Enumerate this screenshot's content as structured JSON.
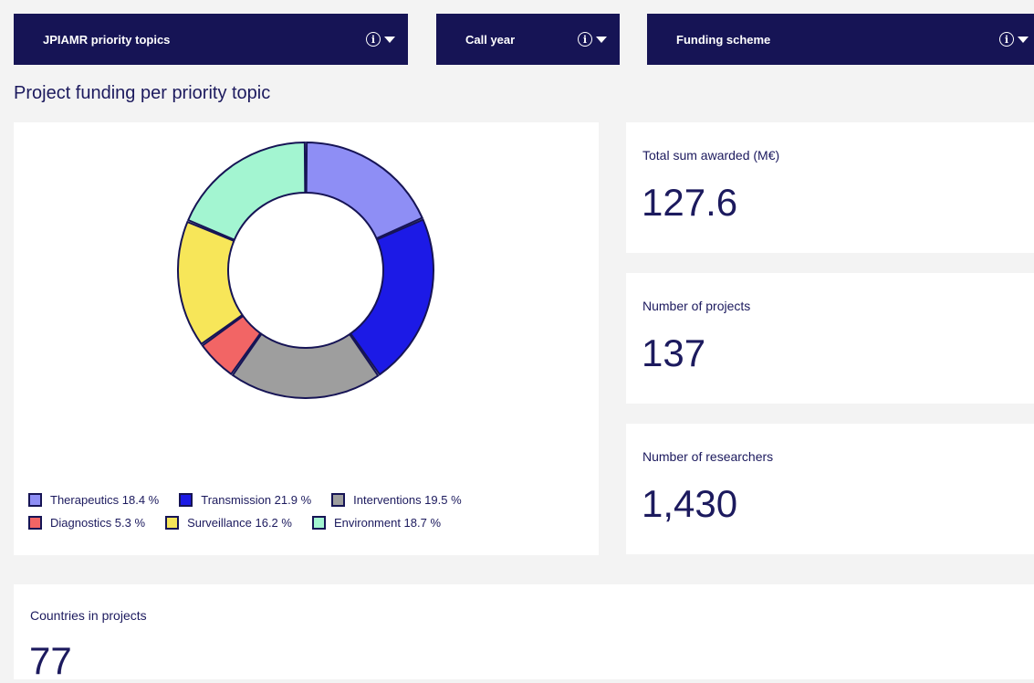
{
  "filters": {
    "topics": {
      "label": "JPIAMR priority topics"
    },
    "year": {
      "label": "Call year"
    },
    "scheme": {
      "label": "Funding scheme"
    }
  },
  "section_title": "Project funding per priority topic",
  "chart_data": {
    "type": "pie",
    "variant": "donut",
    "slices": [
      {
        "label": "Therapeutics",
        "value": 18.4,
        "display": "18.4 %",
        "color": "#8e8ef5"
      },
      {
        "label": "Transmission",
        "value": 21.9,
        "display": "21.9 %",
        "color": "#1c1ae6"
      },
      {
        "label": "Interventions",
        "value": 19.5,
        "display": "19.5 %",
        "color": "#9e9e9e"
      },
      {
        "label": "Diagnostics",
        "value": 5.3,
        "display": "5.3 %",
        "color": "#f26565"
      },
      {
        "label": "Surveillance",
        "value": 16.2,
        "display": "16.2 %",
        "color": "#f7e659"
      },
      {
        "label": "Environment",
        "value": 18.7,
        "display": "18.7 %",
        "color": "#a3f5d1"
      }
    ],
    "legend_placement": "bottom"
  },
  "kpis": {
    "total": {
      "label": "Total sum awarded (M€)",
      "value": "127.6"
    },
    "projects": {
      "label": "Number of projects",
      "value": "137"
    },
    "researchers": {
      "label": "Number of researchers",
      "value": "1,430"
    },
    "countries": {
      "label": "Countries in projects",
      "value": "77"
    }
  },
  "colors": {
    "navy": "#161455",
    "background": "#f3f3f3",
    "panel": "#ffffff"
  }
}
